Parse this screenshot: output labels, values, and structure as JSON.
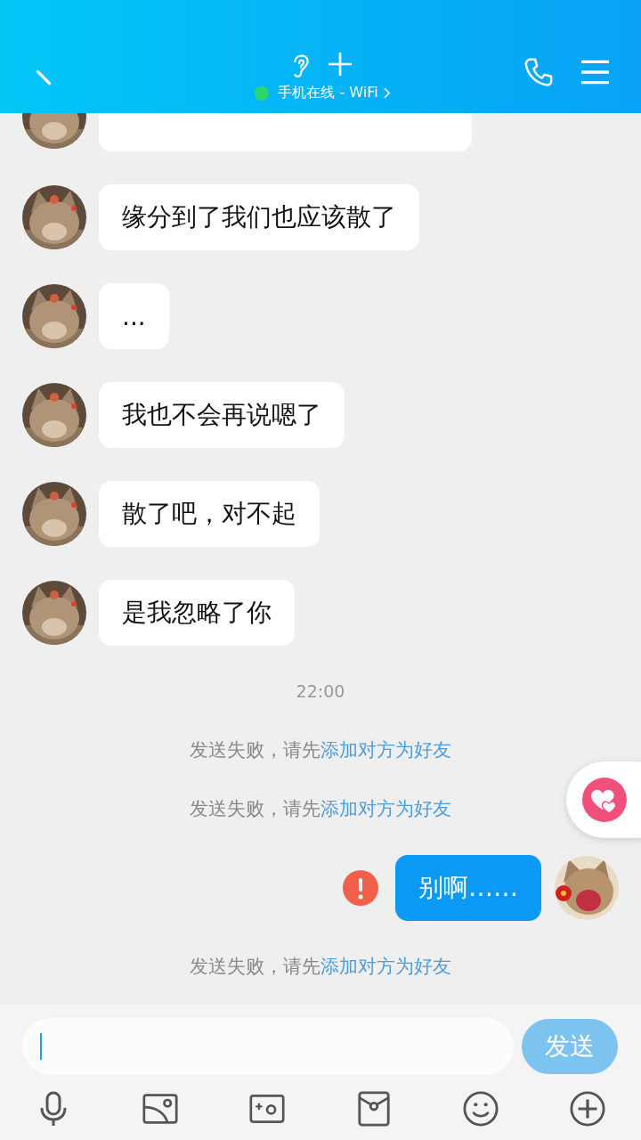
{
  "header": {
    "status_text": "手机在线 - WiFi"
  },
  "messages": [
    {
      "kind": "received_partial"
    },
    {
      "kind": "received",
      "text": "缘分到了我们也应该散了"
    },
    {
      "kind": "received",
      "text": "..."
    },
    {
      "kind": "received",
      "text": "我也不会再说嗯了"
    },
    {
      "kind": "received",
      "text": "散了吧，对不起"
    },
    {
      "kind": "received",
      "text": "是我忽略了你"
    },
    {
      "kind": "time",
      "text": "22:00"
    },
    {
      "kind": "notice",
      "text": "发送失败，请先",
      "link": "添加对方为好友"
    },
    {
      "kind": "notice",
      "text": "发送失败，请先",
      "link": "添加对方为好友"
    },
    {
      "kind": "sent",
      "text": "别啊……",
      "failed": true
    },
    {
      "kind": "notice",
      "text": "发送失败，请先",
      "link": "添加对方为好友"
    }
  ],
  "send_button": {
    "label": "发送",
    "disabled": true
  }
}
